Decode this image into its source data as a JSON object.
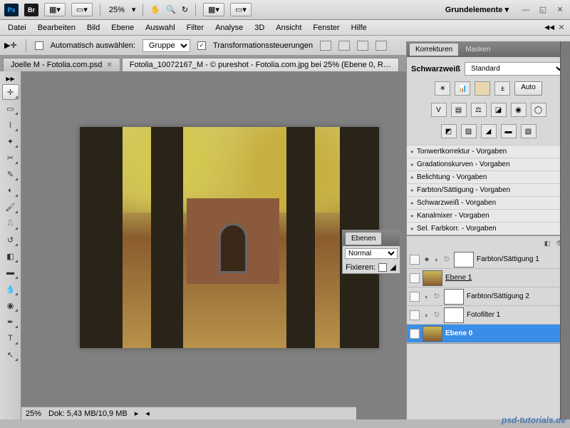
{
  "top": {
    "zoom": "25%",
    "workspace": "Grundelemente"
  },
  "menu": [
    "Datei",
    "Bearbeiten",
    "Bild",
    "Ebene",
    "Auswahl",
    "Filter",
    "Analyse",
    "3D",
    "Ansicht",
    "Fenster",
    "Hilfe"
  ],
  "opt": {
    "auto_select": "Automatisch auswählen:",
    "group": "Gruppe",
    "transform": "Transformationssteuerungen"
  },
  "tabs": [
    {
      "label": "Joelle M - Fotolia.com.psd"
    },
    {
      "label": "Fotolia_10072167_M - © pureshot - Fotolia.com.jpg bei 25% (Ebene 0, R…"
    }
  ],
  "status": {
    "zoom": "25%",
    "doc": "Dok: 5,43 MB/10,9 MB"
  },
  "korrekturen": {
    "tab1": "Korrekturen",
    "tab2": "Masken",
    "bw_label": "Schwarzweiß",
    "bw_preset": "Standard",
    "auto": "Auto",
    "presets": [
      "Tonwertkorrektur - Vorgaben",
      "Gradationskurven - Vorgaben",
      "Belichtung - Vorgaben",
      "Farbton/Sättigung - Vorgaben",
      "Schwarzweiß - Vorgaben",
      "Kanalmixer - Vorgaben",
      "Sel. Farbkorr. - Vorgaben"
    ]
  },
  "layers": {
    "tab": "Ebenen",
    "blend": "Normal",
    "fix": "Fixieren:",
    "items": [
      {
        "name": "Farbton/Sättigung 1"
      },
      {
        "name": "Ebene 1"
      },
      {
        "name": "Farbton/Sättigung 2"
      },
      {
        "name": "Fotofilter 1"
      },
      {
        "name": "Ebene 0"
      }
    ]
  },
  "watermark": "psd-tutorials.de"
}
